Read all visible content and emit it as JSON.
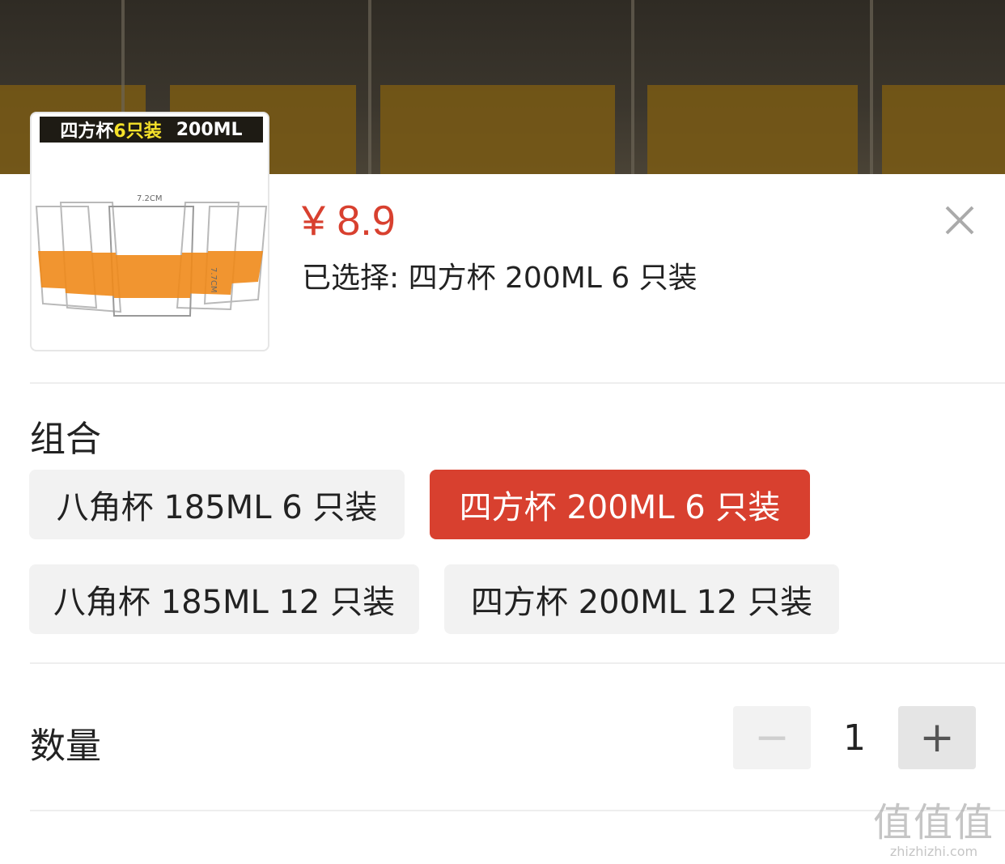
{
  "product": {
    "banner_main": "四方杯",
    "banner_count": "6只装",
    "banner_size": "200ML",
    "dim_width": "7.2CM",
    "dim_height": "7.7CM",
    "price": "¥ 8.9",
    "selected_text": "已选择: 四方杯 200ML 6 只装"
  },
  "options": {
    "title": "组合",
    "items": [
      {
        "label": "八角杯 185ML 6 只装",
        "active": false
      },
      {
        "label": "四方杯 200ML 6 只装",
        "active": true
      },
      {
        "label": "八角杯 185ML 12 只装",
        "active": false
      },
      {
        "label": "四方杯 200ML 12 只装",
        "active": false
      }
    ]
  },
  "quantity": {
    "title": "数量",
    "value": "1",
    "minus": "−",
    "plus": "+"
  },
  "watermark": {
    "main": "值值值",
    "sub": "zhizhizhi.com"
  },
  "colors": {
    "accent": "#d8402f",
    "option_bg": "#f2f2f2"
  }
}
